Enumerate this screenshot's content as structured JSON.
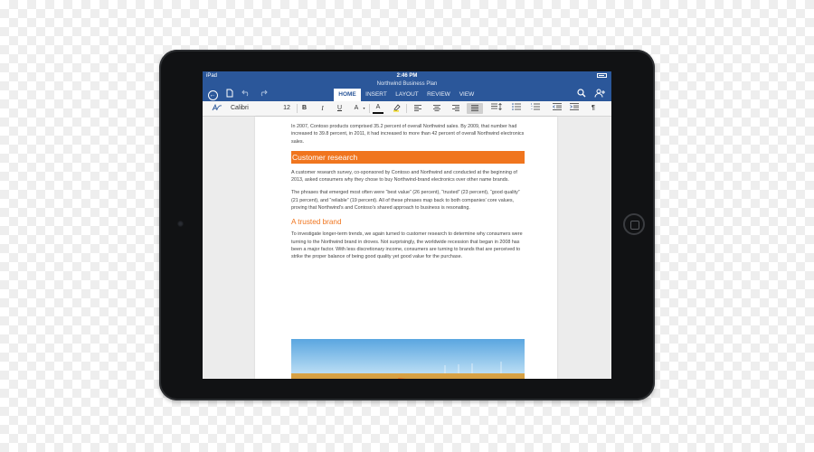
{
  "status_bar": {
    "carrier": "iPad",
    "time": "2:46 PM"
  },
  "document_title": "Northwind Business Plan",
  "ribbon": {
    "icons": [
      "back-icon",
      "file-icon",
      "undo-icon",
      "redo-icon",
      "search-icon",
      "share-icon"
    ],
    "tabs": [
      {
        "label": "HOME",
        "active": true
      },
      {
        "label": "INSERT",
        "active": false
      },
      {
        "label": "LAYOUT",
        "active": false
      },
      {
        "label": "REVIEW",
        "active": false
      },
      {
        "label": "VIEW",
        "active": false
      }
    ]
  },
  "toolbar": {
    "font_name": "Calibri",
    "font_size": "12",
    "bold": "B",
    "italic": "I",
    "underline": "U",
    "text_effects": "A",
    "font_color": "A",
    "paragraph_mark": "¶"
  },
  "document": {
    "para_intro": "In 2007, Contoso products comprised 35.2 percent of overall Northwind sales. By 2009, that number had increased to 39.8 percent, in 2011, it had increased to more than 42 percent of overall Northwind electronics sales.",
    "heading_1": "Customer research",
    "para_research_1": "A customer research survey, co-sponsored by Contoso and Northwind and conducted at the beginning of 2013, asked consumers why they chose to buy Northwind-brand electronics over other name brands.",
    "para_research_2": "The phrases that emerged most often were “best value” (26 percent), “trusted” (23 percent), “good quality” (21 percent), and “reliable” (19 percent). All of these phrases map back to both companies’ core values, proving that Northwind’s and Contoso’s shared approach to business is resonating.",
    "heading_2": "A trusted brand",
    "para_brand": "To investigate longer-term trends, we again turned to customer research to determine why consumers were turning to the Northwind brand in droves. Not surprisingly, the worldwide recession that began in 2008 has been a major factor. With less discretionary income, consumers are turning to brands that are perceived to strike the proper balance of being good quality yet good value for the purchase."
  },
  "colors": {
    "ribbon_blue": "#2b579a",
    "heading_orange": "#f0751e",
    "device_black": "#111214"
  }
}
